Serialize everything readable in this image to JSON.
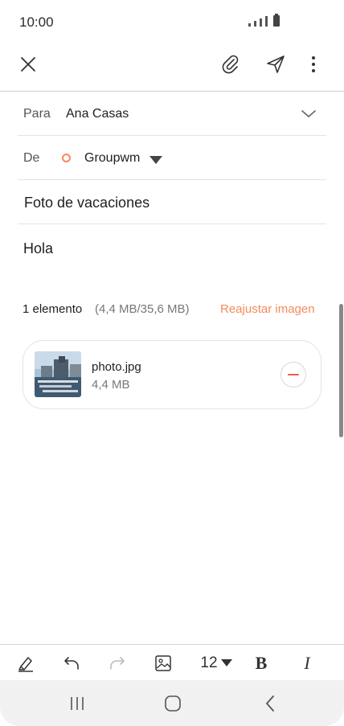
{
  "status_bar": {
    "time": "10:00"
  },
  "toolbar": {
    "close_icon": "close-icon",
    "attach_icon": "paperclip-icon",
    "send_icon": "send-icon",
    "more_icon": "more-vertical-icon"
  },
  "to_field": {
    "label": "Para",
    "value": "Ana Casas"
  },
  "from_field": {
    "label": "De",
    "value": "Groupwm",
    "account_color": "#f58a5b"
  },
  "subject": "Foto de vacaciones",
  "body": "Hola",
  "attachments": {
    "count_label": "1 elemento",
    "size_label": "(4,4 MB/35,6 MB)",
    "resize_label": "Reajustar imagen",
    "accent_color": "#f58a5b",
    "items": [
      {
        "name": "photo.jpg",
        "size": "4,4 MB"
      }
    ]
  },
  "format_bar": {
    "font_size": "12",
    "bold_label": "B",
    "italic_label": "I"
  }
}
